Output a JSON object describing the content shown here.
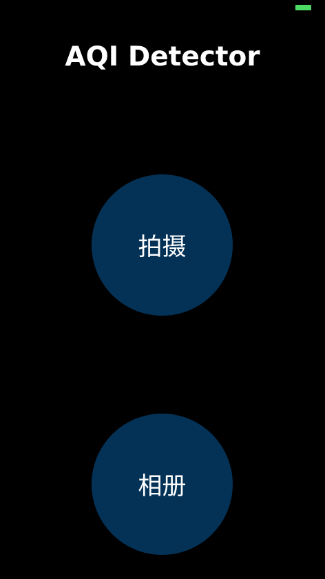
{
  "status_bar": {
    "battery_color": "#4cd964"
  },
  "header": {
    "title": "AQI Detector"
  },
  "actions": {
    "camera_label": "拍摄",
    "album_label": "相册",
    "button_color": "#043257"
  }
}
